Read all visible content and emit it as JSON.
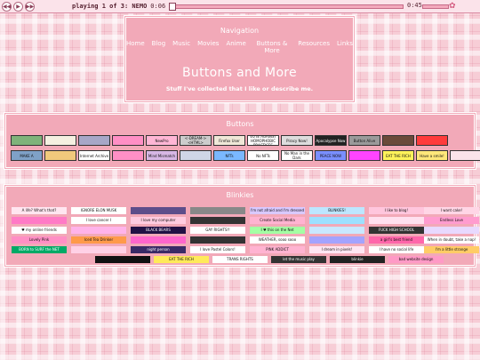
{
  "player": {
    "track": "playing 1 of 3: NEMO",
    "time": "0:06",
    "volume": "0:45",
    "buttons": [
      "◀◀",
      "▶",
      "▶▶"
    ]
  },
  "header": {
    "nav_title": "Navigation",
    "nav": [
      "Home",
      "Blog",
      "Music",
      "Movies",
      "Anime",
      "Buttons & More",
      "Resources",
      "Links"
    ],
    "title": "Buttons and More",
    "subtitle": "Stuff I've collected that I like or describe me."
  },
  "buttons_panel": {
    "title": "Buttons",
    "row1": [
      {
        "text": "",
        "bg": "#7fb37a"
      },
      {
        "text": "",
        "bg": "#f5f0e1"
      },
      {
        "text": "",
        "bg": "#a7a7c7"
      },
      {
        "text": "",
        "bg": "#ff8fc5"
      },
      {
        "text": "NewPro",
        "bg": "#ffb6d5"
      },
      {
        "text": "<-DREAM-> <HTML>",
        "bg": "#cccccc"
      },
      {
        "text": "Firefox User",
        "bg": "#f0e8d8"
      },
      {
        "text": "VOTE AGAINST HOMOPHOBIC PRACTICES",
        "bg": "#ffffff"
      },
      {
        "text": "Piracy Now!",
        "bg": "#dddddd"
      },
      {
        "text": "Apocalypse Now",
        "bg": "#222222"
      },
      {
        "text": "Button Alive",
        "bg": "#9a9a9a"
      },
      {
        "text": "",
        "bg": "#6b4a3a"
      },
      {
        "text": "",
        "bg": "#ff3b3b"
      }
    ],
    "row2": [
      {
        "text": "MAKE A",
        "bg": "#7fa1c7"
      },
      {
        "text": "",
        "bg": "#f1c97c"
      },
      {
        "text": "Internet Archive",
        "bg": "#ffffff"
      },
      {
        "text": "",
        "bg": "#ff8fc5"
      },
      {
        "text": "Mind Mismatch",
        "bg": "#d7b7e5"
      },
      {
        "text": "",
        "bg": "#cfd6e6"
      },
      {
        "text": "NFTs",
        "bg": "#7ab8ff"
      },
      {
        "text": "No NFTs",
        "bg": "#ffffff"
      },
      {
        "text": "No Man in the Dark",
        "bg": "#ffffff"
      },
      {
        "text": "PEACE NOW",
        "bg": "#7a8fff"
      },
      {
        "text": "",
        "bg": "#ff44ff"
      },
      {
        "text": "EAT THE RICH",
        "bg": "#fff35a"
      },
      {
        "text": "Have a smile!",
        "bg": "#ffe77a"
      },
      {
        "text": "",
        "bg": "#fbe3ea"
      }
    ]
  },
  "blinkies_panel": {
    "title": "Blinkies",
    "rows": [
      [
        {
          "text": "A life? What's that?",
          "bg": "#ffe6f0"
        },
        {
          "text": "IGNORE ELON MUSK",
          "bg": "#ffffff"
        },
        {
          "text": "",
          "bg": "#5d4e8a"
        },
        {
          "text": "",
          "bg": "#888888"
        },
        {
          "text": "I'm not afraid and I'm dressed",
          "bg": "#d9c9ff"
        },
        {
          "text": "BLINKIES!",
          "bg": "#bde6ff"
        },
        {
          "text": "I like to blog!",
          "bg": "#ffc6dd"
        },
        {
          "text": "I want cake!",
          "bg": "#ffd6e6"
        }
      ],
      [
        {
          "text": "",
          "bg": "#ff7ac6"
        },
        {
          "text": "I love cancer I",
          "bg": "#ffffff"
        },
        {
          "text": "I love my computer",
          "bg": "#ffcce0"
        },
        {
          "text": "",
          "bg": "#333333"
        },
        {
          "text": "Create Social Media",
          "bg": "#ffb3d1"
        },
        {
          "text": "",
          "bg": "#9de0ff"
        },
        {
          "text": "",
          "bg": "#ffe0ef"
        },
        {
          "text": "Endless Love",
          "bg": "#ff9ccf"
        }
      ],
      [
        {
          "text": "♥ my online friends",
          "bg": "#ffffff"
        },
        {
          "text": "",
          "bg": "#ffb3ea"
        },
        {
          "text": "BLACK BEARS",
          "bg": "#221144"
        },
        {
          "text": "GAY RIGHTS!!",
          "bg": "#ffffff"
        },
        {
          "text": "I ♥ this on the Net",
          "bg": "#a4ffa4"
        },
        {
          "text": "",
          "bg": "#c9e8ff"
        },
        {
          "text": "FUCK HIGH SCHOOL",
          "bg": "#333333"
        },
        {
          "text": "",
          "bg": "#e8d9ff"
        }
      ],
      [
        {
          "text": "Lovely Pink",
          "bg": "#ff8fc5"
        },
        {
          "text": "Iced Tea Drinker",
          "bg": "#ff9a4a"
        },
        {
          "text": "",
          "bg": "#ff66cc"
        },
        {
          "text": "",
          "bg": "#333333"
        },
        {
          "text": "WEATHER, sooo sooo",
          "bg": "#ffffff"
        },
        {
          "text": "",
          "bg": "#a3a3ff"
        },
        {
          "text": "a girl's best friend",
          "bg": "#ff66aa"
        },
        {
          "text": "When in doubt, take a nap!",
          "bg": "#ffffff"
        }
      ],
      [
        {
          "text": "BORN to SURF the NET",
          "bg": "#00aa66"
        },
        {
          "text": "",
          "bg": "#ffd1e6"
        },
        {
          "text": "night person",
          "bg": "#3a2a66"
        },
        {
          "text": "I love Pastel Colors!",
          "bg": "#ffffff"
        },
        {
          "text": "PINK ADDICT",
          "bg": "#ffb3d1"
        },
        {
          "text": "I dream in pixels!",
          "bg": "#ffe6f3"
        },
        {
          "text": "I have no social life",
          "bg": "#ffffff"
        },
        {
          "text": "I'm a little strange",
          "bg": "#ffcc66"
        }
      ],
      [
        {
          "text": "",
          "bg": "#111111"
        },
        {
          "text": "EAT THE RICH",
          "bg": "#ffea5a"
        },
        {
          "text": "TRANS RIGHTS",
          "bg": "#ffffff"
        },
        {
          "text": "let the music play",
          "bg": "#333333"
        },
        {
          "text": "blinkie",
          "bg": "#222222"
        },
        {
          "text": "bad website design",
          "bg": "#ff9ac6"
        }
      ]
    ]
  }
}
